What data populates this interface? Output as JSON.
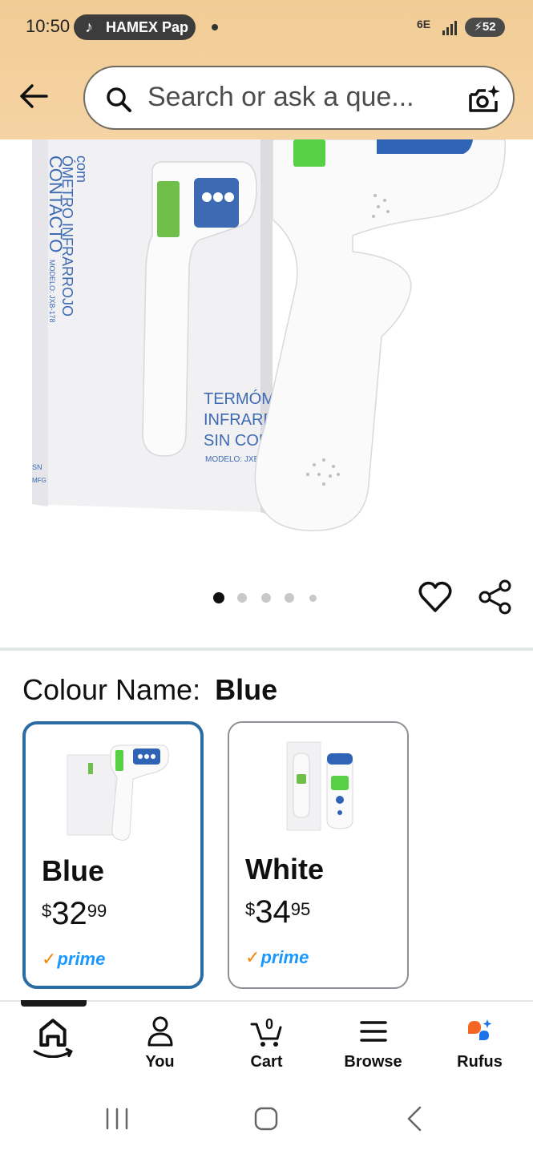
{
  "status_bar": {
    "time": "10:50",
    "notification_pill": "HAMEX Pap",
    "network": "6E",
    "battery": "52"
  },
  "search": {
    "placeholder": "Search or ask a que..."
  },
  "product_image": {
    "box_text_1": "TERMÓMET",
    "box_text_2": "INFRARRO",
    "box_text_3": "SIN CON",
    "box_text_4": "MODELO: JXB-178",
    "box_side_1": "ÓMETRO INFRARROJO",
    "box_side_2": "CONTACTO",
    "box_side_3": "MODELO: JXB-178",
    "box_brand": "com",
    "box_mark_1": "SN",
    "box_mark_2": "MFG",
    "carousel_count": 5,
    "carousel_active": 0
  },
  "colour": {
    "label": "Colour Name:",
    "selected": "Blue"
  },
  "variants": [
    {
      "name": "Blue",
      "currency": "$",
      "whole": "32",
      "fraction": "99",
      "prime": "prime"
    },
    {
      "name": "White",
      "currency": "$",
      "whole": "34",
      "fraction": "95",
      "prime": "prime"
    }
  ],
  "bottom_nav": {
    "items": [
      {
        "label": "",
        "icon": "home-icon"
      },
      {
        "label": "You",
        "icon": "user-icon"
      },
      {
        "label": "Cart",
        "icon": "cart-icon",
        "badge": "0"
      },
      {
        "label": "Browse",
        "icon": "menu-icon"
      },
      {
        "label": "Rufus",
        "icon": "rufus-icon"
      }
    ]
  },
  "colors": {
    "header_bg": "#f3cf9a",
    "selected_border": "#2b6ca3",
    "prime_blue": "#1a98ff",
    "prime_check": "#f08804"
  }
}
